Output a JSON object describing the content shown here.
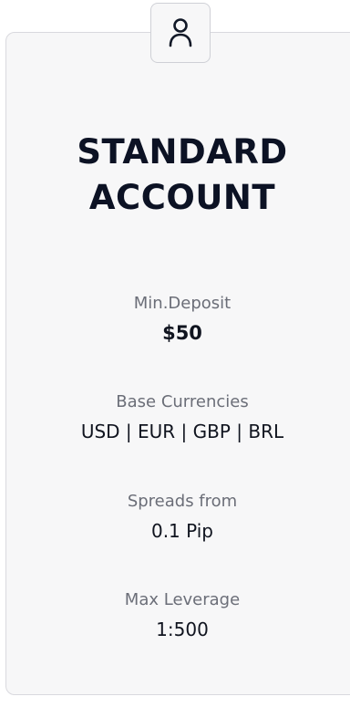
{
  "account": {
    "title_line1": "STANDARD",
    "title_line2": "ACCOUNT",
    "icon": "user-icon"
  },
  "stats": [
    {
      "label": "Min.Deposit",
      "value": "$50"
    },
    {
      "label": "Base Currencies",
      "value": "USD | EUR | GBP | BRL"
    },
    {
      "label": "Spreads from",
      "value": "0.1 Pip"
    },
    {
      "label": "Max Leverage",
      "value": "1:500"
    }
  ],
  "colors": {
    "card_background": "#f7f7f8",
    "card_border": "#d9d9de",
    "title": "#0c1224",
    "label": "#6b6e78",
    "value": "#10141f"
  }
}
